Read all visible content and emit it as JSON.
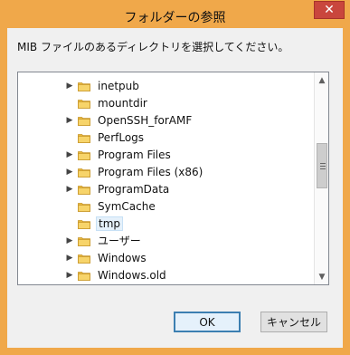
{
  "dialog": {
    "title": "フォルダーの参照",
    "close_glyph": "✕",
    "prompt": "MIB ファイルのあるディレクトリを選択してください。"
  },
  "tree": {
    "items": [
      {
        "label": "inetpub",
        "expandable": true,
        "selected": false
      },
      {
        "label": "mountdir",
        "expandable": false,
        "selected": false
      },
      {
        "label": "OpenSSH_forAMF",
        "expandable": true,
        "selected": false
      },
      {
        "label": "PerfLogs",
        "expandable": false,
        "selected": false
      },
      {
        "label": "Program Files",
        "expandable": true,
        "selected": false
      },
      {
        "label": "Program Files (x86)",
        "expandable": true,
        "selected": false
      },
      {
        "label": "ProgramData",
        "expandable": true,
        "selected": false
      },
      {
        "label": "SymCache",
        "expandable": false,
        "selected": false
      },
      {
        "label": "tmp",
        "expandable": false,
        "selected": true
      },
      {
        "label": "ユーザー",
        "expandable": true,
        "selected": false
      },
      {
        "label": "Windows",
        "expandable": true,
        "selected": false
      },
      {
        "label": "Windows.old",
        "expandable": true,
        "selected": false
      }
    ]
  },
  "buttons": {
    "ok": "OK",
    "cancel": "キャンセル"
  },
  "colors": {
    "titlebar": "#f0a84a",
    "close": "#c9463d",
    "folder": "#e8b93c",
    "selection": "#e5f1fb"
  },
  "icons": {
    "close": "close-icon",
    "folder": "folder-icon",
    "expand": "chevron-right-icon",
    "scroll_up": "chevron-up-icon",
    "scroll_down": "chevron-down-icon"
  }
}
